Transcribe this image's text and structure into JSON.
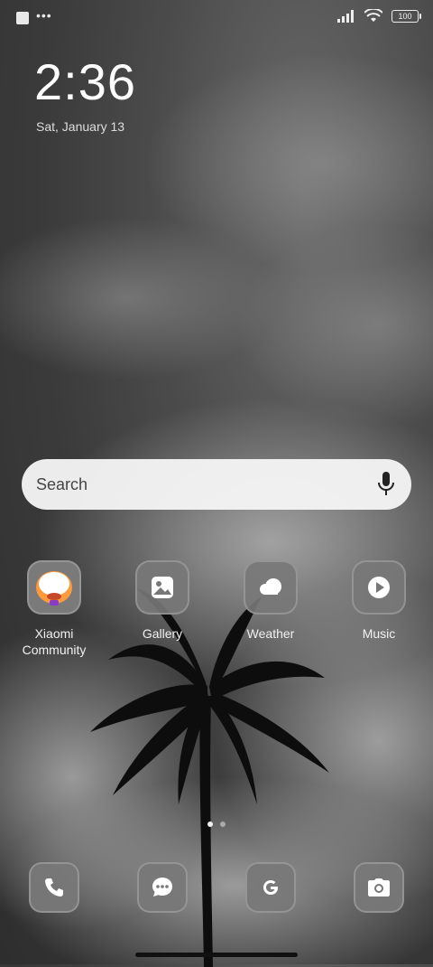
{
  "status_bar": {
    "battery_level": "100"
  },
  "lockscreen": {
    "time": "2:36",
    "date": "Sat, January 13"
  },
  "search": {
    "placeholder_label": "Search"
  },
  "apps": [
    {
      "label": "Xiaomi\nCommunity",
      "icon": "xiaomi-community-icon"
    },
    {
      "label": "Gallery",
      "icon": "gallery-icon"
    },
    {
      "label": "Weather",
      "icon": "weather-icon"
    },
    {
      "label": "Music",
      "icon": "music-icon"
    }
  ],
  "dock": [
    {
      "icon": "phone-icon"
    },
    {
      "icon": "messages-icon"
    },
    {
      "icon": "google-icon"
    },
    {
      "icon": "camera-icon"
    }
  ],
  "pager": {
    "pages": 2,
    "active": 1
  }
}
